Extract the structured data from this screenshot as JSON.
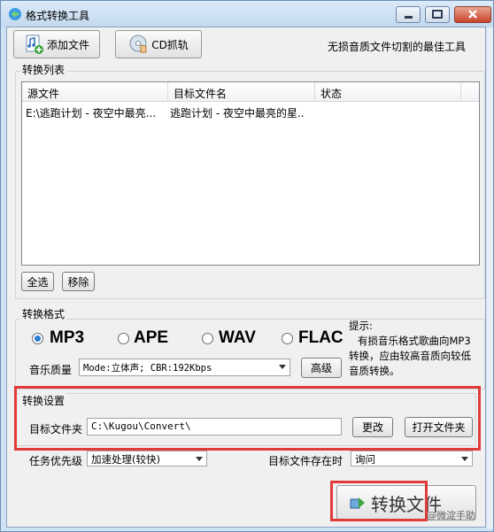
{
  "window": {
    "title": "格式转换工具",
    "minimize_icon": "minimize-icon",
    "maximize_icon": "maximize-icon",
    "close_icon": "close-icon"
  },
  "toolbar": {
    "add_file_label": "添加文件",
    "cd_rip_label": "CD抓轨",
    "slogan": "无损音质文件切割的最佳工具"
  },
  "convert_list": {
    "title": "转换列表",
    "columns": [
      "源文件",
      "目标文件名",
      "状态"
    ],
    "rows": [
      {
        "source": "E:\\逃跑计划 - 夜空中最亮...",
        "target": "逃跑计划 - 夜空中最亮的星..",
        "status": ""
      }
    ],
    "select_all_label": "全选",
    "remove_label": "移除"
  },
  "format": {
    "title": "转换格式",
    "options": [
      "MP3",
      "APE",
      "WAV",
      "FLAC"
    ],
    "selected": "MP3",
    "quality_label": "音乐质量",
    "quality_value": "Mode:立体声; CBR:192Kbps",
    "advanced_label": "高级",
    "hint_title": "提示:",
    "hint_body": "有损音乐格式歌曲向MP3转换，应由较高音质向较低音质转换。"
  },
  "settings": {
    "title": "转换设置",
    "target_folder_label": "目标文件夹",
    "target_folder_value": "C:\\Kugou\\Convert\\",
    "change_label": "更改",
    "open_folder_label": "打开文件夹",
    "priority_label": "任务优先级",
    "priority_value": "加速处理(较快)",
    "exists_label": "目标文件存在时",
    "exists_value": "询问"
  },
  "footer": {
    "convert_label": "转换文件",
    "watermark": "@微淀手助"
  },
  "colors": {
    "highlight": "#e03a3a",
    "radio_selected": "#2a7fd4"
  }
}
